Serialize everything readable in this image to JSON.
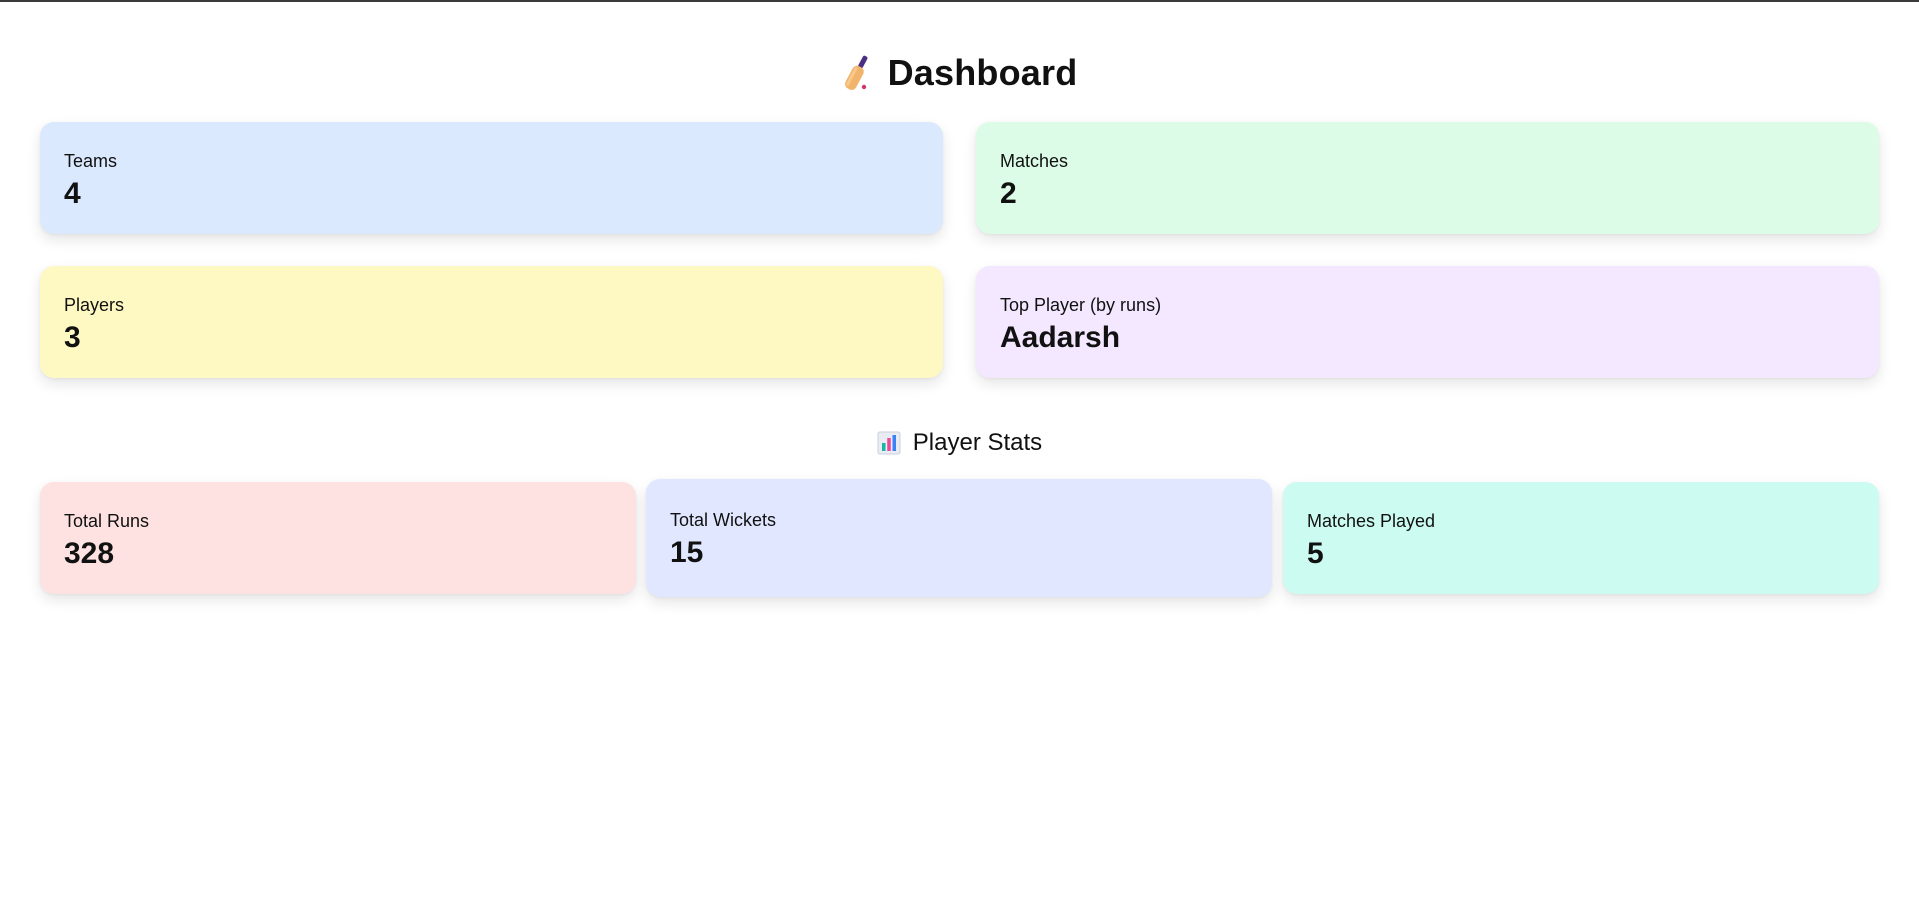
{
  "header": {
    "title": "Dashboard",
    "icon": "cricket-bat-icon"
  },
  "summary_cards": {
    "teams": {
      "label": "Teams",
      "value": "4",
      "color": "#dbe9fe"
    },
    "matches": {
      "label": "Matches",
      "value": "2",
      "color": "#dcfce7"
    },
    "players": {
      "label": "Players",
      "value": "3",
      "color": "#fef9c3"
    },
    "top_player": {
      "label": "Top Player (by runs)",
      "value": "Aadarsh",
      "color": "#f3e8ff"
    }
  },
  "player_stats": {
    "title": "Player Stats",
    "icon": "bar-chart-icon",
    "total_runs": {
      "label": "Total Runs",
      "value": "328",
      "color": "#fee2e2"
    },
    "total_wickets": {
      "label": "Total Wickets",
      "value": "15",
      "color": "#e0e7ff"
    },
    "matches_played": {
      "label": "Matches Played",
      "value": "5",
      "color": "#ccfbf1"
    }
  }
}
